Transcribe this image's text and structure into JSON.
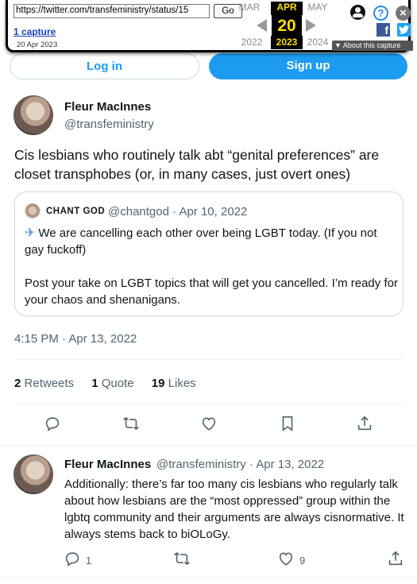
{
  "wayback": {
    "url": "https://twitter.com/transfeministry/status/15",
    "go_label": "Go",
    "captures_link": "1 capture",
    "capture_date": "20 Apr 2023",
    "prev_month": "MAR",
    "cur_month": "APR",
    "next_month": "MAY",
    "day": "20",
    "prev_year": "2022",
    "cur_year": "2023",
    "next_year": "2024",
    "about_label": "▼ About this capture"
  },
  "auth": {
    "login_label": "Log in",
    "signup_label": "Sign up"
  },
  "tweet": {
    "author_name": "Fleur MacInnes",
    "author_handle": "@transfeministry",
    "text": "Cis lesbians who routinely talk abt “genital preferences” are closet transphobes (or, in many cases, just overt ones)",
    "timestamp": "4:15 PM · Apr 13, 2022",
    "quote": {
      "name": "CHANT GOD",
      "handle_date": "@chantgod · Apr 10, 2022",
      "plane": "✈",
      "para1": "We are cancelling each other over being LGBT today. (If you not gay fuckoff)",
      "para2": "Post your take on LGBT topics that will get you cancelled. I’m ready for your chaos and shenanigans."
    },
    "stats": {
      "retweets_count": "2",
      "retweets_label": "Retweets",
      "quotes_count": "1",
      "quotes_label": "Quote",
      "likes_count": "19",
      "likes_label": "Likes"
    }
  },
  "reply": {
    "author_name": "Fleur MacInnes",
    "handle_date": "@transfeministry · Apr 13, 2022",
    "text": "Additionally: there’s far too many cis lesbians who regularly talk about how lesbians are the “most oppressed” group within the lgbtq community and their arguments are always cisnormative. It always stems back to biOLoGy.",
    "reply_count": "1",
    "like_count": "9"
  }
}
